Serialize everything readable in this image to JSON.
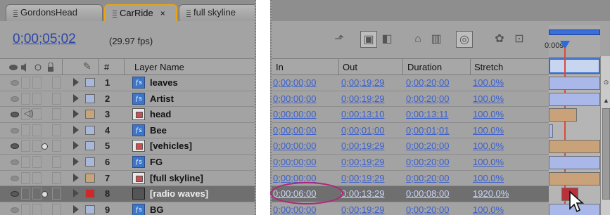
{
  "left": {
    "tabs": [
      {
        "label": "GordonsHead",
        "active": false
      },
      {
        "label": "CarRide",
        "active": true,
        "close": "×"
      },
      {
        "label": "full skyline",
        "active": false
      }
    ],
    "timecode": "0;00;05;02",
    "fps": "(29.97 fps)",
    "headers": {
      "hash": "#",
      "layer_name": "Layer Name"
    },
    "layers": [
      {
        "num": "1",
        "name": "leaves",
        "icon": "footage-icon",
        "label_color": "#a9b8d8",
        "eye": false,
        "audio": false,
        "solo": false
      },
      {
        "num": "2",
        "name": "Artist",
        "icon": "footage-icon",
        "label_color": "#a9b8d8",
        "eye": false,
        "audio": false,
        "solo": false
      },
      {
        "num": "3",
        "name": "head",
        "icon": "composition-icon",
        "label_color": "#c7a57a",
        "eye": true,
        "audio": true,
        "solo": false
      },
      {
        "num": "4",
        "name": "Bee",
        "icon": "footage-icon",
        "label_color": "#a9b8d8",
        "eye": false,
        "audio": false,
        "solo": false
      },
      {
        "num": "5",
        "name": "[vehicles]",
        "icon": "composition-icon",
        "label_color": "#a9b8d8",
        "eye": true,
        "audio": false,
        "solo": true
      },
      {
        "num": "6",
        "name": "FG",
        "icon": "footage-icon",
        "label_color": "#a9b8d8",
        "eye": false,
        "audio": false,
        "solo": false
      },
      {
        "num": "7",
        "name": "[full skyline]",
        "icon": "composition-icon",
        "label_color": "#c7a57a",
        "eye": false,
        "audio": false,
        "solo": false
      },
      {
        "num": "8",
        "name": "[radio waves]",
        "icon": "solid-icon",
        "label_color": "#cc2a2a",
        "eye": true,
        "audio": false,
        "solo": true,
        "selected": true
      },
      {
        "num": "9",
        "name": "BG",
        "icon": "footage-icon",
        "label_color": "#a9b8d8",
        "eye": false,
        "audio": false,
        "solo": false
      }
    ]
  },
  "right": {
    "headers": {
      "in": "In",
      "out": "Out",
      "duration": "Duration",
      "stretch": "Stretch"
    },
    "ruler_label": "0:00s",
    "rows": [
      {
        "in": "0;00;00;00",
        "out": "0;00;19;29",
        "duration": "0;00;20;00",
        "stretch": "100.0%",
        "bar_color": "#a9b8e8"
      },
      {
        "in": "0;00;00;00",
        "out": "0;00;19;29",
        "duration": "0;00;20;00",
        "stretch": "100.0%",
        "bar_color": "#a9b8e8"
      },
      {
        "in": "0;00;00;00",
        "out": "0;00;13;10",
        "duration": "0;00;13;11",
        "stretch": "100.0%",
        "bar_color": "#c9a27a"
      },
      {
        "in": "0;00;00;00",
        "out": "0;00;01;00",
        "duration": "0;00;01;01",
        "stretch": "100.0%",
        "bar_color": "#a9b8e8"
      },
      {
        "in": "0;00;00;00",
        "out": "0;00;19;29",
        "duration": "0;00;20;00",
        "stretch": "100.0%",
        "bar_color": "#c9a27a"
      },
      {
        "in": "0;00;00;00",
        "out": "0;00;19;29",
        "duration": "0;00;20;00",
        "stretch": "100.0%",
        "bar_color": "#a9b8e8"
      },
      {
        "in": "0;00;00;00",
        "out": "0;00;19;29",
        "duration": "0;00;20;00",
        "stretch": "100.0%",
        "bar_color": "#c9a27a"
      },
      {
        "in": "0;00;06;00",
        "out": "0;00;13;29",
        "duration": "0;00;08;00",
        "stretch": "1920.0%",
        "bar_color": "#b8323a",
        "selected": true
      },
      {
        "in": "0;00;00;00",
        "out": "0;00;19;29",
        "duration": "0;00;20;00",
        "stretch": "100.0%",
        "bar_color": "#a9b8e8"
      }
    ],
    "toolbar_icons": [
      "flowchart-icon",
      "composition-mini-icon",
      "draft-3d-icon",
      "hide-shy-icon",
      "frame-blending-icon",
      "motion-blur-icon",
      "brainstorm-icon",
      "graph-editor-icon"
    ]
  }
}
